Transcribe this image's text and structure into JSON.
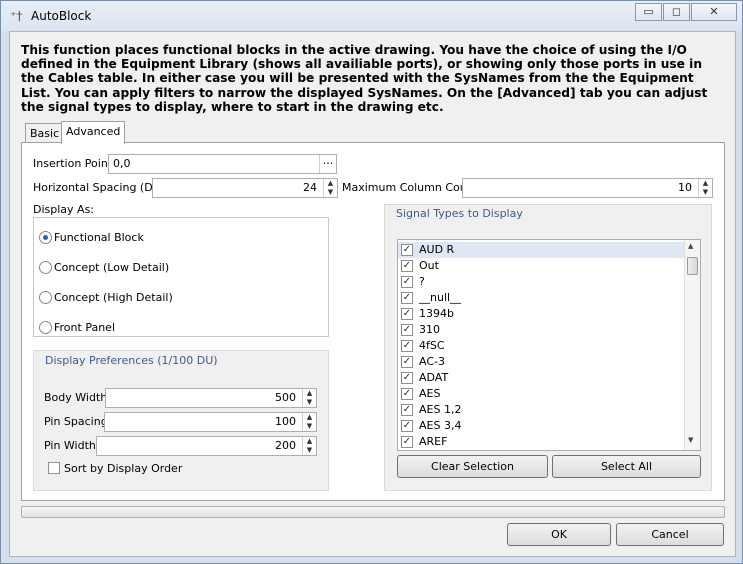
{
  "window": {
    "title": "AutoBlock",
    "minimize": "▭",
    "maximize": "◻",
    "close": "✕"
  },
  "description": "This function places functional blocks in the active drawing. You have the choice of using the I/O defined in the Equipment Library (shows all availiable ports), or showing only those ports in use in the Cables table. In either case you will be presented with the SysNames from the the Equipment List. You can apply filters to narrow the displayed SysNames. On the [Advanced] tab you can adjust the signal types to display, where to start in the drawing etc.",
  "tabs": [
    {
      "label": "Basic",
      "active": false
    },
    {
      "label": "Advanced",
      "active": true
    }
  ],
  "advanced": {
    "insertion_point": {
      "label": "Insertion Point",
      "value": "0,0",
      "browse": "···"
    },
    "horizontal_spacing": {
      "label": "Horizontal Spacing (DU)",
      "value": "24"
    },
    "max_column_count": {
      "label": "Maximum Column Count",
      "value": "10"
    },
    "display_as": {
      "label": "Display As:",
      "options": [
        {
          "label": "Functional Block",
          "selected": true
        },
        {
          "label": "Concept (Low Detail)",
          "selected": false
        },
        {
          "label": "Concept (High Detail)",
          "selected": false
        },
        {
          "label": "Front Panel",
          "selected": false
        }
      ]
    },
    "display_prefs": {
      "title": "Display Preferences (1/100 DU)",
      "body_width": {
        "label": "Body Width",
        "value": "500"
      },
      "pin_spacing": {
        "label": "Pin Spacing",
        "value": "100"
      },
      "pin_width": {
        "label": "Pin Width",
        "value": "200"
      },
      "sort": {
        "label": "Sort by Display Order",
        "checked": false
      }
    },
    "signal_types": {
      "title": "Signal Types to Display",
      "items": [
        "AUD R",
        "Out",
        "?",
        "__null__",
        "1394b",
        "310",
        "4fSC",
        "AC-3",
        "ADAT",
        "AES",
        "AES 1,2",
        "AES 3,4",
        "AREF"
      ],
      "clear_label": "Clear Selection",
      "select_all_label": "Select All"
    }
  },
  "footer": {
    "ok": "OK",
    "cancel": "Cancel"
  },
  "colors": {
    "accent": "#3a5b8c",
    "selection": "#dde8f4"
  }
}
